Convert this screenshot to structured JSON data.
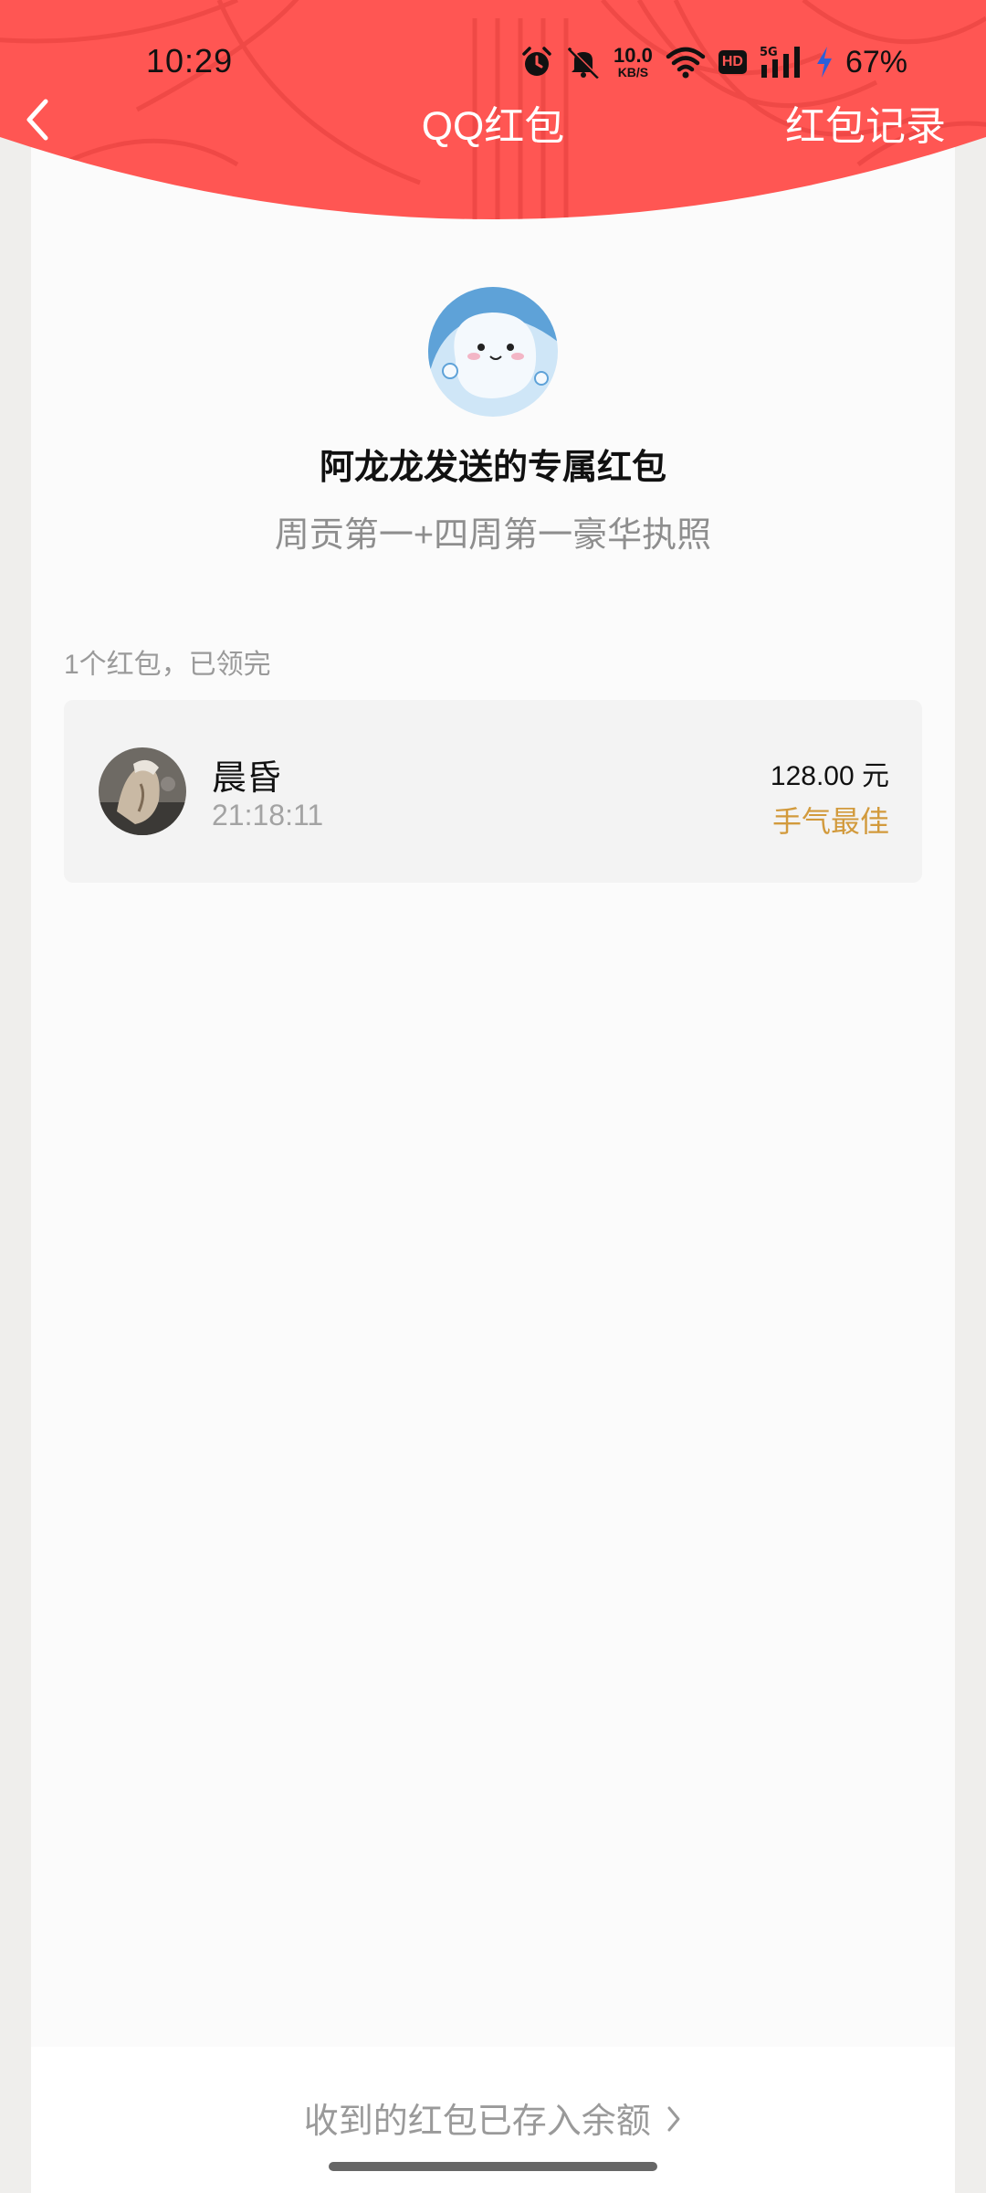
{
  "status_bar": {
    "time": "10:29",
    "net_speed_value": "10.0",
    "net_speed_unit": "KB/S",
    "hd_label": "HD",
    "signal_label": "5G",
    "battery": "67%",
    "icons": [
      "alarm-icon",
      "mute-icon",
      "wifi-icon",
      "hd-icon",
      "signal-icon",
      "charging-icon"
    ]
  },
  "nav": {
    "back_icon": "chevron-left-icon",
    "title": "QQ红包",
    "record_link": "红包记录"
  },
  "red_packet": {
    "sender_title": "阿龙龙发送的专属红包",
    "blessing": "周贡第一+四周第一豪华执照",
    "summary": "1个红包，已领完"
  },
  "receivers": [
    {
      "name": "晨昏",
      "time": "21:18:11",
      "amount": "128.00 元",
      "tag": "手气最佳"
    }
  ],
  "footer": {
    "balance_link": "收到的红包已存入余额"
  },
  "colors": {
    "header_red": "#ff5653",
    "best_luck": "#d29a3c"
  }
}
